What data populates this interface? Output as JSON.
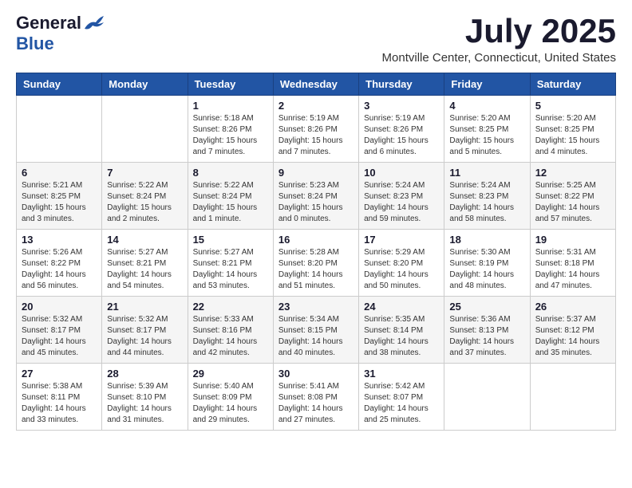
{
  "logo": {
    "general": "General",
    "blue": "Blue"
  },
  "title": "July 2025",
  "location": "Montville Center, Connecticut, United States",
  "weekdays": [
    "Sunday",
    "Monday",
    "Tuesday",
    "Wednesday",
    "Thursday",
    "Friday",
    "Saturday"
  ],
  "weeks": [
    [
      {
        "day": "",
        "info": ""
      },
      {
        "day": "",
        "info": ""
      },
      {
        "day": "1",
        "info": "Sunrise: 5:18 AM\nSunset: 8:26 PM\nDaylight: 15 hours and 7 minutes."
      },
      {
        "day": "2",
        "info": "Sunrise: 5:19 AM\nSunset: 8:26 PM\nDaylight: 15 hours and 7 minutes."
      },
      {
        "day": "3",
        "info": "Sunrise: 5:19 AM\nSunset: 8:26 PM\nDaylight: 15 hours and 6 minutes."
      },
      {
        "day": "4",
        "info": "Sunrise: 5:20 AM\nSunset: 8:25 PM\nDaylight: 15 hours and 5 minutes."
      },
      {
        "day": "5",
        "info": "Sunrise: 5:20 AM\nSunset: 8:25 PM\nDaylight: 15 hours and 4 minutes."
      }
    ],
    [
      {
        "day": "6",
        "info": "Sunrise: 5:21 AM\nSunset: 8:25 PM\nDaylight: 15 hours and 3 minutes."
      },
      {
        "day": "7",
        "info": "Sunrise: 5:22 AM\nSunset: 8:24 PM\nDaylight: 15 hours and 2 minutes."
      },
      {
        "day": "8",
        "info": "Sunrise: 5:22 AM\nSunset: 8:24 PM\nDaylight: 15 hours and 1 minute."
      },
      {
        "day": "9",
        "info": "Sunrise: 5:23 AM\nSunset: 8:24 PM\nDaylight: 15 hours and 0 minutes."
      },
      {
        "day": "10",
        "info": "Sunrise: 5:24 AM\nSunset: 8:23 PM\nDaylight: 14 hours and 59 minutes."
      },
      {
        "day": "11",
        "info": "Sunrise: 5:24 AM\nSunset: 8:23 PM\nDaylight: 14 hours and 58 minutes."
      },
      {
        "day": "12",
        "info": "Sunrise: 5:25 AM\nSunset: 8:22 PM\nDaylight: 14 hours and 57 minutes."
      }
    ],
    [
      {
        "day": "13",
        "info": "Sunrise: 5:26 AM\nSunset: 8:22 PM\nDaylight: 14 hours and 56 minutes."
      },
      {
        "day": "14",
        "info": "Sunrise: 5:27 AM\nSunset: 8:21 PM\nDaylight: 14 hours and 54 minutes."
      },
      {
        "day": "15",
        "info": "Sunrise: 5:27 AM\nSunset: 8:21 PM\nDaylight: 14 hours and 53 minutes."
      },
      {
        "day": "16",
        "info": "Sunrise: 5:28 AM\nSunset: 8:20 PM\nDaylight: 14 hours and 51 minutes."
      },
      {
        "day": "17",
        "info": "Sunrise: 5:29 AM\nSunset: 8:20 PM\nDaylight: 14 hours and 50 minutes."
      },
      {
        "day": "18",
        "info": "Sunrise: 5:30 AM\nSunset: 8:19 PM\nDaylight: 14 hours and 48 minutes."
      },
      {
        "day": "19",
        "info": "Sunrise: 5:31 AM\nSunset: 8:18 PM\nDaylight: 14 hours and 47 minutes."
      }
    ],
    [
      {
        "day": "20",
        "info": "Sunrise: 5:32 AM\nSunset: 8:17 PM\nDaylight: 14 hours and 45 minutes."
      },
      {
        "day": "21",
        "info": "Sunrise: 5:32 AM\nSunset: 8:17 PM\nDaylight: 14 hours and 44 minutes."
      },
      {
        "day": "22",
        "info": "Sunrise: 5:33 AM\nSunset: 8:16 PM\nDaylight: 14 hours and 42 minutes."
      },
      {
        "day": "23",
        "info": "Sunrise: 5:34 AM\nSunset: 8:15 PM\nDaylight: 14 hours and 40 minutes."
      },
      {
        "day": "24",
        "info": "Sunrise: 5:35 AM\nSunset: 8:14 PM\nDaylight: 14 hours and 38 minutes."
      },
      {
        "day": "25",
        "info": "Sunrise: 5:36 AM\nSunset: 8:13 PM\nDaylight: 14 hours and 37 minutes."
      },
      {
        "day": "26",
        "info": "Sunrise: 5:37 AM\nSunset: 8:12 PM\nDaylight: 14 hours and 35 minutes."
      }
    ],
    [
      {
        "day": "27",
        "info": "Sunrise: 5:38 AM\nSunset: 8:11 PM\nDaylight: 14 hours and 33 minutes."
      },
      {
        "day": "28",
        "info": "Sunrise: 5:39 AM\nSunset: 8:10 PM\nDaylight: 14 hours and 31 minutes."
      },
      {
        "day": "29",
        "info": "Sunrise: 5:40 AM\nSunset: 8:09 PM\nDaylight: 14 hours and 29 minutes."
      },
      {
        "day": "30",
        "info": "Sunrise: 5:41 AM\nSunset: 8:08 PM\nDaylight: 14 hours and 27 minutes."
      },
      {
        "day": "31",
        "info": "Sunrise: 5:42 AM\nSunset: 8:07 PM\nDaylight: 14 hours and 25 minutes."
      },
      {
        "day": "",
        "info": ""
      },
      {
        "day": "",
        "info": ""
      }
    ]
  ]
}
